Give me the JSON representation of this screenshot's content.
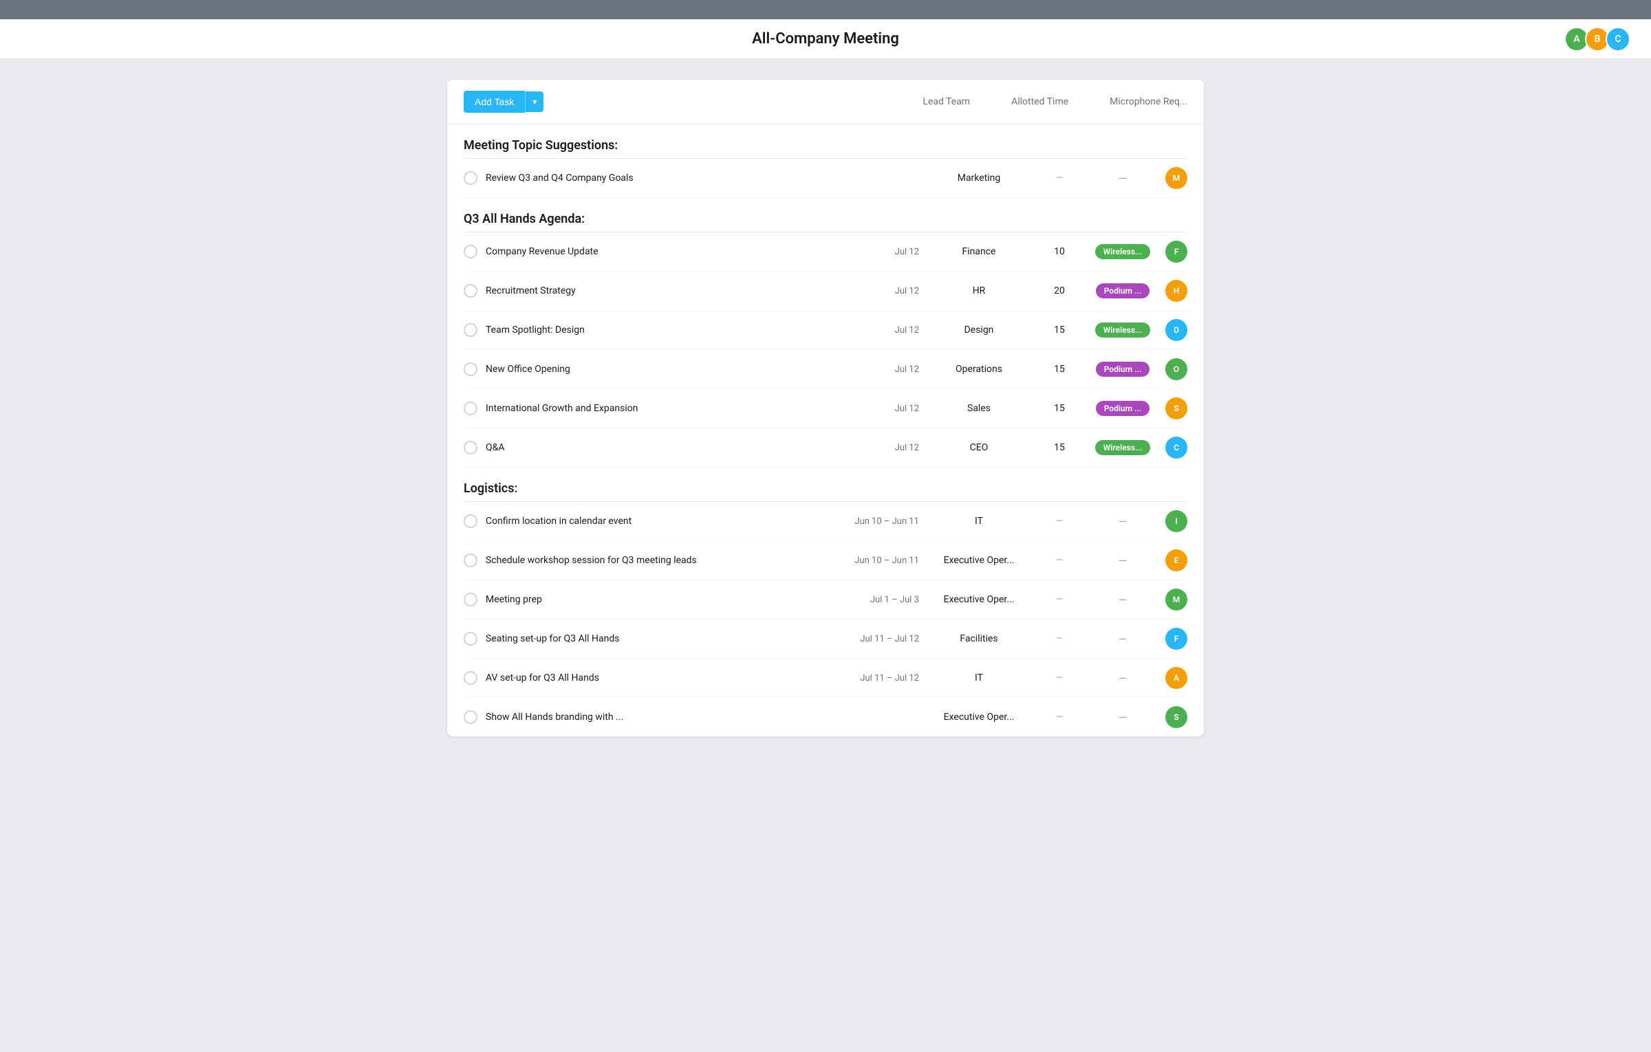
{
  "topBar": {},
  "header": {
    "title": "All-Company Meeting",
    "avatars": [
      {
        "color": "#4caf50",
        "initials": "A"
      },
      {
        "color": "#f59e0b",
        "initials": "B"
      },
      {
        "color": "#29b6f6",
        "initials": "C"
      }
    ]
  },
  "toolbar": {
    "addTaskLabel": "Add Task",
    "columns": [
      "Lead Team",
      "Allotted Time",
      "Microphone Req..."
    ]
  },
  "sections": [
    {
      "title": "Meeting Topic Suggestions:",
      "tasks": [
        {
          "name": "Review Q3 and Q4 Company Goals",
          "date": "",
          "team": "Marketing",
          "time": "—",
          "mic": "—",
          "avatarColor": "#f59e0b",
          "avatarInitial": "M"
        }
      ]
    },
    {
      "title": "Q3 All Hands Agenda:",
      "tasks": [
        {
          "name": "Company Revenue Update",
          "date": "Jul 12",
          "team": "Finance",
          "time": "10",
          "mic": "Wireless...",
          "micType": "green",
          "avatarColor": "#4caf50",
          "avatarInitial": "F"
        },
        {
          "name": "Recruitment Strategy",
          "date": "Jul 12",
          "team": "HR",
          "time": "20",
          "mic": "Podium ...",
          "micType": "purple",
          "avatarColor": "#f59e0b",
          "avatarInitial": "H"
        },
        {
          "name": "Team Spotlight: Design",
          "date": "Jul 12",
          "team": "Design",
          "time": "15",
          "mic": "Wireless...",
          "micType": "green",
          "avatarColor": "#29b6f6",
          "avatarInitial": "D"
        },
        {
          "name": "New Office Opening",
          "date": "Jul 12",
          "team": "Operations",
          "time": "15",
          "mic": "Podium ...",
          "micType": "purple",
          "avatarColor": "#4caf50",
          "avatarInitial": "O"
        },
        {
          "name": "International Growth and Expansion",
          "date": "Jul 12",
          "team": "Sales",
          "time": "15",
          "mic": "Podium ...",
          "micType": "purple",
          "avatarColor": "#f59e0b",
          "avatarInitial": "S"
        },
        {
          "name": "Q&A",
          "date": "Jul 12",
          "team": "CEO",
          "time": "15",
          "mic": "Wireless...",
          "micType": "green",
          "avatarColor": "#29b6f6",
          "avatarInitial": "C"
        }
      ]
    },
    {
      "title": "Logistics:",
      "tasks": [
        {
          "name": "Confirm location in calendar event",
          "date": "Jun 10 – Jun 11",
          "team": "IT",
          "time": "—",
          "mic": "—",
          "avatarColor": "#4caf50",
          "avatarInitial": "I"
        },
        {
          "name": "Schedule workshop session for Q3 meeting leads",
          "date": "Jun 10 – Jun 11",
          "team": "Executive Oper...",
          "time": "—",
          "mic": "—",
          "avatarColor": "#f59e0b",
          "avatarInitial": "E"
        },
        {
          "name": "Meeting prep",
          "date": "Jul 1 – Jul 3",
          "team": "Executive Oper...",
          "time": "—",
          "mic": "—",
          "avatarColor": "#4caf50",
          "avatarInitial": "M"
        },
        {
          "name": "Seating set-up for Q3 All Hands",
          "date": "Jul 11 – Jul 12",
          "team": "Facilities",
          "time": "—",
          "mic": "—",
          "avatarColor": "#29b6f6",
          "avatarInitial": "F"
        },
        {
          "name": "AV set-up for Q3 All Hands",
          "date": "Jul 11 – Jul 12",
          "team": "IT",
          "time": "—",
          "mic": "—",
          "avatarColor": "#f59e0b",
          "avatarInitial": "A"
        },
        {
          "name": "Show All Hands branding with ...",
          "date": "",
          "team": "Executive Oper...",
          "time": "—",
          "mic": "—",
          "avatarColor": "#4caf50",
          "avatarInitial": "S"
        }
      ]
    }
  ]
}
